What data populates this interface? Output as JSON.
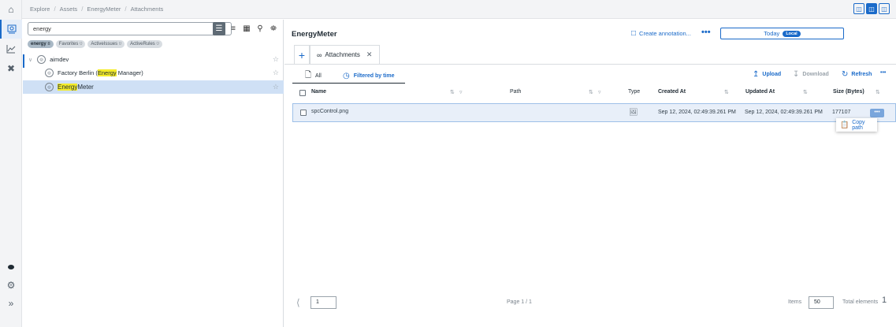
{
  "breadcrumb": [
    "Explore",
    "Assets",
    "EnergyMeter",
    "Attachments"
  ],
  "tree": {
    "search_value": "energy",
    "chips": [
      {
        "label": "energy",
        "count": "8",
        "active": true
      },
      {
        "label": "Favorites",
        "count": "0"
      },
      {
        "label": "ActiveIssues",
        "count": "0"
      },
      {
        "label": "ActiveRules",
        "count": "0"
      }
    ],
    "nodes": [
      {
        "label": "aimdev"
      },
      {
        "pre": "Factory Berlin (",
        "hl": "Energy",
        "post": " Manager)"
      },
      {
        "pre": "",
        "hl": "Energy",
        "post": "Meter"
      }
    ]
  },
  "main": {
    "title": "EnergyMeter",
    "annotation_label": "Create annotation...",
    "more": "•••",
    "time_label": "Today",
    "time_badge": "Local",
    "tab_label": "Attachments",
    "subtabs": {
      "all": "All",
      "time": "Filtered by time"
    },
    "actions": {
      "upload": "Upload",
      "download": "Download",
      "refresh": "Refresh"
    },
    "columns": {
      "name": "Name",
      "path": "Path",
      "type": "Type",
      "created": "Created At",
      "updated": "Updated At",
      "size": "Size (Bytes)"
    },
    "row": {
      "name": "spcControl.png",
      "created": "Sep 12, 2024, 02:49:39.261 PM",
      "updated": "Sep 12, 2024, 02:49:39.261 PM",
      "size": "177107"
    },
    "popup_label": "Copy path",
    "pager": {
      "page_value": "1",
      "page_label": "Page 1 / 1",
      "items_label": "Items",
      "items_value": "50",
      "total_label": "Total elements",
      "total_value": "1"
    }
  }
}
